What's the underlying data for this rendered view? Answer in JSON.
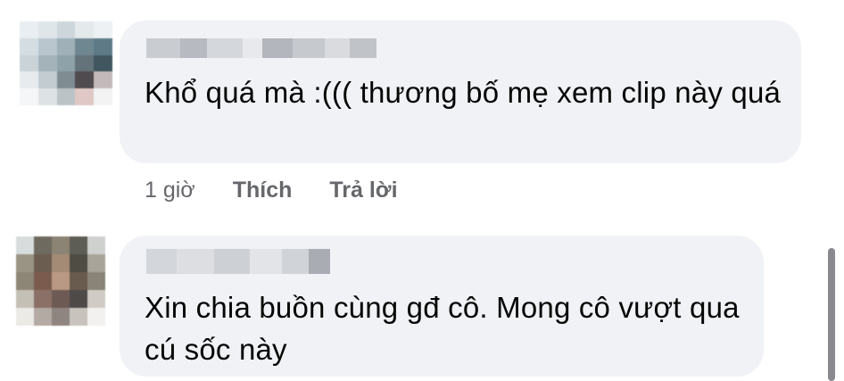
{
  "comments": [
    {
      "text": "Khổ quá mà :((( thương bố mẹ xem clip này quá",
      "time": "1 giờ",
      "like_label": "Thích",
      "reply_label": "Trả lời"
    },
    {
      "text": "Xin chia buồn cùng gđ cô. Mong cô vượt qua cú sốc này"
    }
  ],
  "colors": {
    "bubble": "#f0f2f5",
    "text": "#050505",
    "meta": "#65676b"
  }
}
